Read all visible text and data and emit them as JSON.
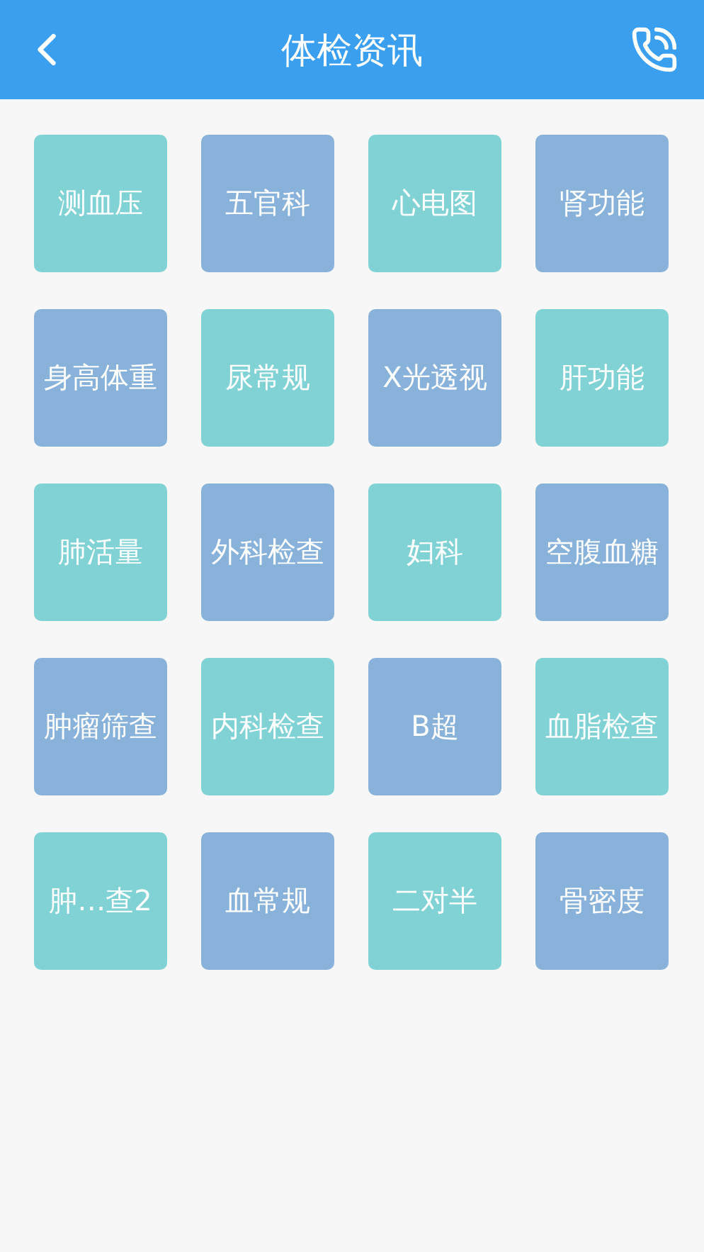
{
  "header": {
    "title": "体检资讯"
  },
  "items": [
    {
      "label": "测血压",
      "color": "#80d2d4"
    },
    {
      "label": "五官科",
      "color": "#88b2d9"
    },
    {
      "label": "心电图",
      "color": "#80d2d4"
    },
    {
      "label": "肾功能",
      "color": "#88b2d9"
    },
    {
      "label": "身高体重",
      "color": "#88b2d9"
    },
    {
      "label": "尿常规",
      "color": "#80d2d4"
    },
    {
      "label": "X光透视",
      "color": "#88b2d9"
    },
    {
      "label": "肝功能",
      "color": "#80d2d4"
    },
    {
      "label": "肺活量",
      "color": "#80d2d4"
    },
    {
      "label": "外科检查",
      "color": "#88b2d9"
    },
    {
      "label": "妇科",
      "color": "#80d2d4"
    },
    {
      "label": "空腹血糖",
      "color": "#88b2d9"
    },
    {
      "label": "肿瘤筛查",
      "color": "#88b2d9"
    },
    {
      "label": "内科检查",
      "color": "#80d2d4"
    },
    {
      "label": "B超",
      "color": "#88b2d9"
    },
    {
      "label": "血脂检查",
      "color": "#80d2d4"
    },
    {
      "label": "肿…查2",
      "color": "#80d2d4"
    },
    {
      "label": "血常规",
      "color": "#88b2d9"
    },
    {
      "label": "二对半",
      "color": "#80d2d4"
    },
    {
      "label": "骨密度",
      "color": "#88b2d9"
    }
  ]
}
